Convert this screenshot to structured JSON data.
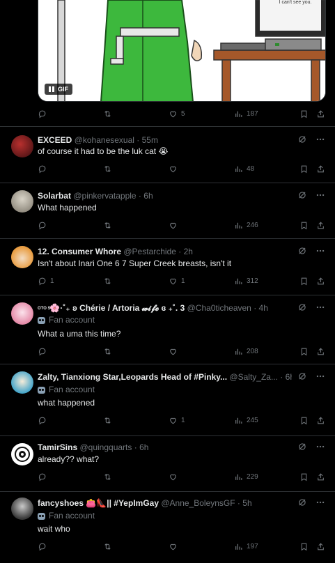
{
  "top_post": {
    "gif_label": "GIF",
    "monitor_text": "I can't see you.",
    "stats": {
      "replies": "",
      "reposts": "",
      "likes": "5",
      "views": "187"
    }
  },
  "tweets": [
    {
      "name": "EXCEED",
      "handle": "@kohanesexual",
      "time": "55m",
      "fan_account": "",
      "text": "of course it had to be the luk cat 😭",
      "stats": {
        "replies": "",
        "reposts": "",
        "likes": "",
        "views": "48"
      }
    },
    {
      "name": "Solarbat",
      "handle": "@pinkervatapple",
      "time": "6h",
      "fan_account": "",
      "text": "What happened",
      "stats": {
        "replies": "",
        "reposts": "",
        "likes": "",
        "views": "246"
      }
    },
    {
      "name": "12. Consumer Whore",
      "handle": "@Pestarchide",
      "time": "2h",
      "fan_account": "",
      "text": "Isn't about Inari One 6 7 Super Creek breasts, isn't it",
      "stats": {
        "replies": "1",
        "reposts": "",
        "likes": "1",
        "views": "312"
      }
    },
    {
      "name": "🌸·˚₊ ʚ Chérie / Artoria 𝔀𝓲𝓯𝓮 ɞ ₊˚. 3",
      "name_prefix": "OTO SOC",
      "handle": "@Cha0ticheaven",
      "time": "4h",
      "fan_account": "Fan account",
      "text": "What a uma this time?",
      "stats": {
        "replies": "",
        "reposts": "",
        "likes": "",
        "views": "208"
      }
    },
    {
      "name": "Zalty, Tianxiong Star,Leopards Head of #Pinky...",
      "handle": "@Salty_Za...",
      "time": "6h",
      "fan_account": "Fan account",
      "text": "what happened",
      "stats": {
        "replies": "",
        "reposts": "",
        "likes": "1",
        "views": "245"
      }
    },
    {
      "name": "TamirSins",
      "handle": "@quingquarts",
      "time": "6h",
      "fan_account": "",
      "text": "already?? what?",
      "stats": {
        "replies": "",
        "reposts": "",
        "likes": "",
        "views": "229"
      }
    },
    {
      "name": "fancyshoes 👛👠|| #YepImGay",
      "handle": "@Anne_BoleynsGF",
      "time": "5h",
      "fan_account": "Fan account",
      "text": "wait who",
      "stats": {
        "replies": "",
        "reposts": "",
        "likes": "",
        "views": "197"
      }
    }
  ],
  "icons": {
    "reply": "reply-icon",
    "repost": "repost-icon",
    "like": "heart-icon",
    "views": "views-chart-icon",
    "bookmark": "bookmark-icon",
    "share": "share-icon",
    "grok": "grok-icon",
    "more": "more-icon",
    "fan": "fan-mask-icon"
  },
  "colors": {
    "background": "#000000",
    "text": "#e7e9ea",
    "muted": "#71767b",
    "border": "#2f3336"
  }
}
